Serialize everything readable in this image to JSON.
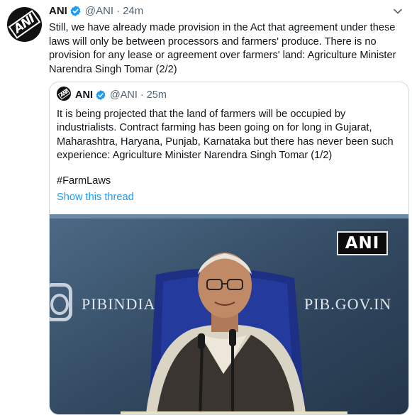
{
  "tweet": {
    "name": "ANI",
    "handle": "@ANI",
    "separator": "·",
    "time": "24m",
    "text": "Still, we have already made provision in the Act that agreement under these laws will only be between processors and farmers' produce. There is no provision for any lease or agreement over farmers' land: Agriculture Minister Narendra Singh Tomar (2/2)",
    "avatar_logo": "ANI"
  },
  "quoted": {
    "name": "ANI",
    "handle": "@ANI",
    "separator": "·",
    "time": "25m",
    "avatar_logo": "ANI",
    "text": "It is being projected that the land of farmers will be occupied by industrialists. Contract farming has been going on for long in Gujarat, Maharashtra, Haryana, Punjab, Karnataka but there has never been such experience: Agriculture Minister Narendra Singh Tomar (1/2)",
    "hashtag": "#FarmLaws",
    "show_thread": "Show this thread",
    "media": {
      "badge": "ANI",
      "backdrop_left": "PIBINDIA",
      "backdrop_right": "PIB.GOV.IN"
    }
  },
  "colors": {
    "link": "#1d9bf0",
    "secondary_text": "#536471",
    "verified": "#1d9bf0"
  },
  "icons": [
    "verified-badge-icon",
    "chevron-down-icon",
    "instagram-icon"
  ]
}
